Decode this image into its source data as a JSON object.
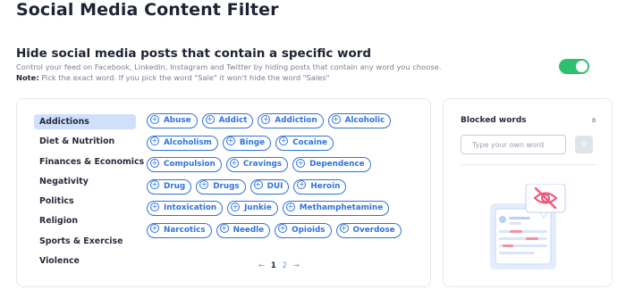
{
  "page": {
    "title": "Social Media Content Filter"
  },
  "section": {
    "title": "Hide social media posts that contain a specific word",
    "description": "Control your feed on Facebook, Linkedin, Instagram and Twitter by hiding posts that contain any word you choose.",
    "note_label": "Note:",
    "note_text": " Pick the exact word. If you pick the word \"Sale\" it won't hide the word \"Sales\""
  },
  "toggle": {
    "state": "on",
    "color": "#2fbf71"
  },
  "categories": [
    {
      "label": "Addictions",
      "active": true
    },
    {
      "label": "Diet & Nutrition",
      "active": false
    },
    {
      "label": "Finances & Economics",
      "active": false
    },
    {
      "label": "Negativity",
      "active": false
    },
    {
      "label": "Politics",
      "active": false
    },
    {
      "label": "Religion",
      "active": false
    },
    {
      "label": "Sports & Exercise",
      "active": false
    },
    {
      "label": "Violence",
      "active": false
    }
  ],
  "word_rows": [
    [
      "Abuse",
      "Addict",
      "Addiction",
      "Alcoholic"
    ],
    [
      "Alcoholism",
      "Binge",
      "Cocaine"
    ],
    [
      "Compulsion",
      "Cravings",
      "Dependence"
    ],
    [
      "Drug",
      "Drugs",
      "DUI",
      "Heroin"
    ],
    [
      "Intoxication",
      "Junkie",
      "Methamphetamine"
    ],
    [
      "Narcotics",
      "Needle",
      "Opioids",
      "Overdose"
    ]
  ],
  "chip_icon": "plus-circle-icon",
  "pagination": {
    "prev": "←",
    "pages": [
      "1",
      "2"
    ],
    "current": "1",
    "next": "→"
  },
  "blocked": {
    "title": "Blocked words",
    "count": "0",
    "input_placeholder": "Type your own word",
    "add_label": "+",
    "illustration": "hidden-post-eye-slash-icon"
  },
  "colors": {
    "accent": "#2f72e0",
    "active_category": "#cfe0fb",
    "text": "#1f2433"
  }
}
